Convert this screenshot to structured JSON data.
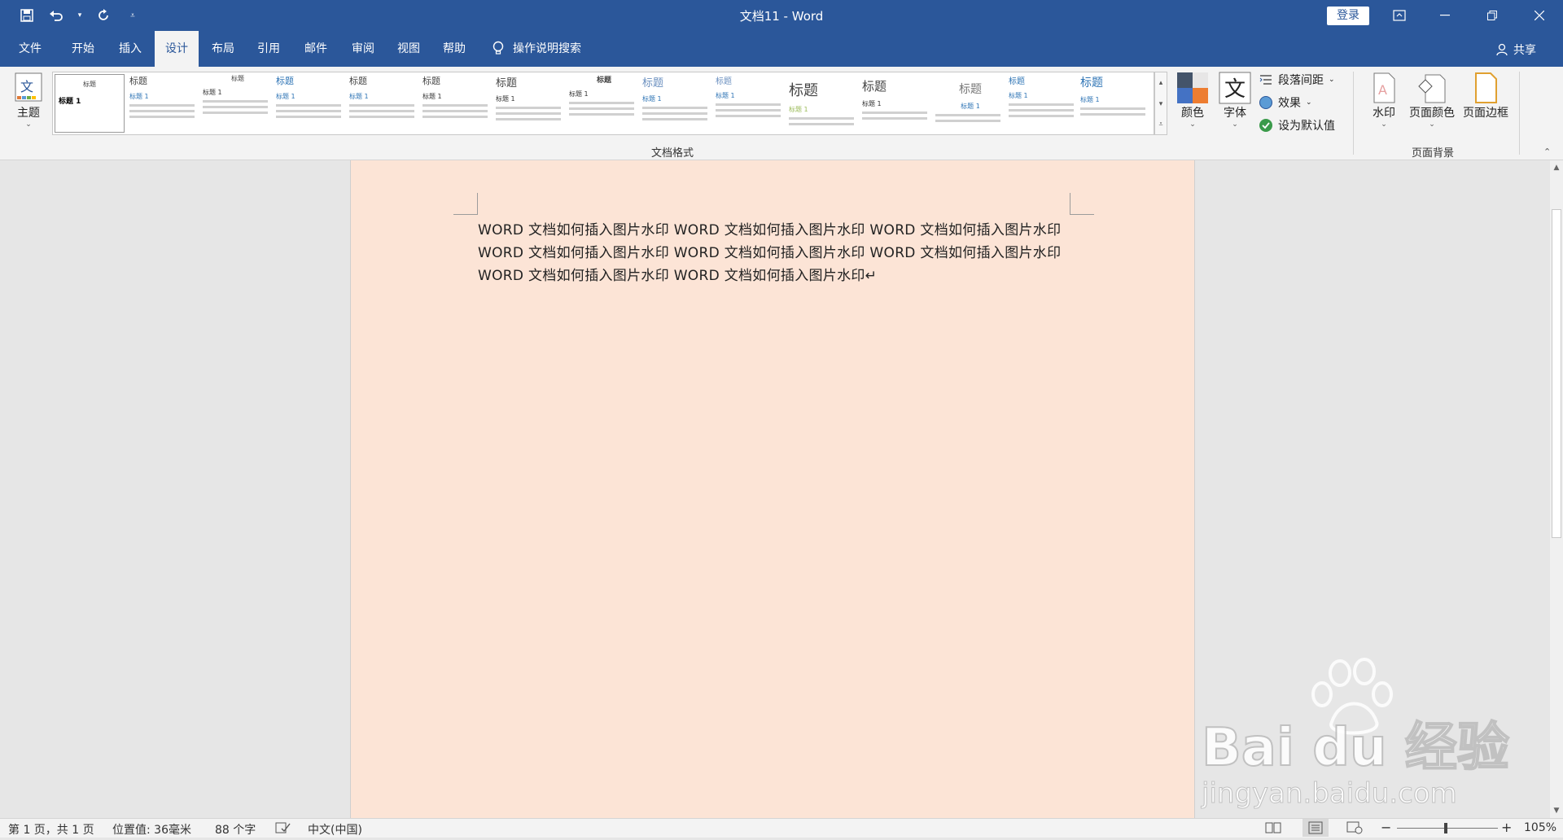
{
  "window": {
    "title": "文档11  -  Word",
    "login_label": "登录",
    "share_label": "共享"
  },
  "tabs": [
    {
      "label": "文件"
    },
    {
      "label": "开始"
    },
    {
      "label": "插入"
    },
    {
      "label": "设计"
    },
    {
      "label": "布局"
    },
    {
      "label": "引用"
    },
    {
      "label": "邮件"
    },
    {
      "label": "审阅"
    },
    {
      "label": "视图"
    },
    {
      "label": "帮助"
    }
  ],
  "tell_me": "操作说明搜索",
  "ribbon": {
    "theme_label": "主题",
    "doc_format_label": "文档格式",
    "gallery_title": "标题",
    "gallery_heading1": "标题 1",
    "colors_label": "颜色",
    "fonts_label": "字体",
    "paragraph_spacing_label": "段落间距",
    "effects_label": "效果",
    "set_default_label": "设为默认值",
    "watermark_label": "水印",
    "page_color_label": "页面颜色",
    "page_border_label": "页面边框",
    "page_background_label": "页面背景"
  },
  "document": {
    "text": "WORD 文档如何插入图片水印 WORD 文档如何插入图片水印 WORD 文档如何插入图片水印 WORD 文档如何插入图片水印 WORD 文档如何插入图片水印 WORD 文档如何插入图片水印 WORD 文档如何插入图片水印 WORD 文档如何插入图片水印↵",
    "page_color": "#fce4d6"
  },
  "watermark_overlay": {
    "brand": "Bai du 经验",
    "url": "jingyan.baidu.com"
  },
  "status": {
    "page": "第 1 页，共 1 页",
    "position": "位置值: 36毫米",
    "words": "88 个字",
    "language": "中文(中国)",
    "zoom": "105%"
  },
  "colors": {
    "accent": "#2b579a",
    "ribbon_bg": "#f3f3f3"
  }
}
